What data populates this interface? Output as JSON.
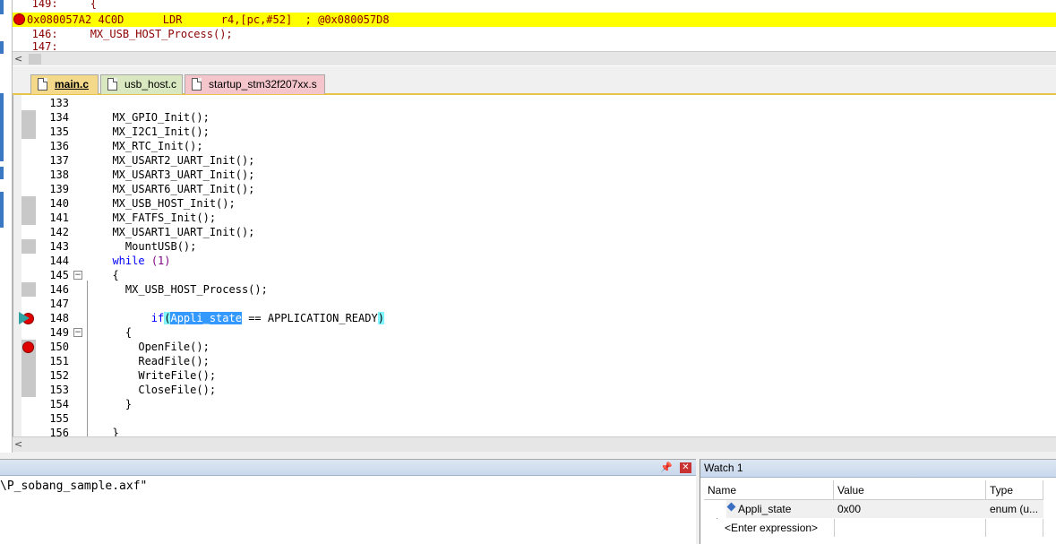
{
  "disassembly": {
    "lines": [
      {
        "text": "   149:     {",
        "kind": "source"
      },
      {
        "text": "0x080057A2 4C0D      LDR      r4,[pc,#52]  ; @0x080057D8",
        "kind": "current"
      },
      {
        "text": "   146:     MX_USB_HOST_Process();",
        "kind": "source"
      },
      {
        "text": "   147:",
        "kind": "source"
      }
    ]
  },
  "tabs": [
    {
      "label": "main.c",
      "active": true,
      "color": "#f5d98b"
    },
    {
      "label": "usb_host.c",
      "active": false,
      "color": "#d9e8c0"
    },
    {
      "label": "startup_stm32f207xx.s",
      "active": false,
      "color": "#f4c6cc"
    }
  ],
  "editor": {
    "lines": [
      {
        "n": "133",
        "code": ""
      },
      {
        "n": "134",
        "code": "  MX_GPIO_Init();"
      },
      {
        "n": "135",
        "code": "  MX_I2C1_Init();"
      },
      {
        "n": "136",
        "code": "  MX_RTC_Init();"
      },
      {
        "n": "137",
        "code": "  MX_USART2_UART_Init();"
      },
      {
        "n": "138",
        "code": "  MX_USART3_UART_Init();"
      },
      {
        "n": "139",
        "code": "  MX_USART6_UART_Init();"
      },
      {
        "n": "140",
        "code": "  MX_USB_HOST_Init();"
      },
      {
        "n": "141",
        "code": "  MX_FATFS_Init();"
      },
      {
        "n": "142",
        "code": "  MX_USART1_UART_Init();"
      },
      {
        "n": "143",
        "code": "    MountUSB();"
      },
      {
        "n": "144",
        "code": ""
      },
      {
        "n": "145",
        "code": "  {"
      },
      {
        "n": "146",
        "code": "    MX_USB_HOST_Process();"
      },
      {
        "n": "147",
        "code": ""
      },
      {
        "n": "148",
        "code": ""
      },
      {
        "n": "149",
        "code": "    {"
      },
      {
        "n": "150",
        "code": "      OpenFile();"
      },
      {
        "n": "151",
        "code": "      ReadFile();"
      },
      {
        "n": "152",
        "code": "      WriteFile();"
      },
      {
        "n": "153",
        "code": "      CloseFile();"
      },
      {
        "n": "154",
        "code": "    }"
      },
      {
        "n": "155",
        "code": ""
      },
      {
        "n": "156",
        "code": "  }"
      }
    ],
    "while_kw": "while",
    "while_num": "(1)",
    "if_indent": "        ",
    "if_kw": "if",
    "if_paren_open": "(",
    "if_var": "Appli_state",
    "if_rest": " == APPLICATION_READY",
    "if_paren_close": ")"
  },
  "output": {
    "text": "\\P_sobang_sample.axf\"",
    "pin_icon": "pin-icon",
    "close_icon": "close-icon"
  },
  "watch": {
    "title": "Watch 1",
    "columns": [
      "Name",
      "Value",
      "Type"
    ],
    "rows": [
      {
        "name": "Appli_state",
        "value": "0x00",
        "type": "enum (u..."
      },
      {
        "name": "<Enter expression>",
        "value": "",
        "type": ""
      }
    ]
  }
}
